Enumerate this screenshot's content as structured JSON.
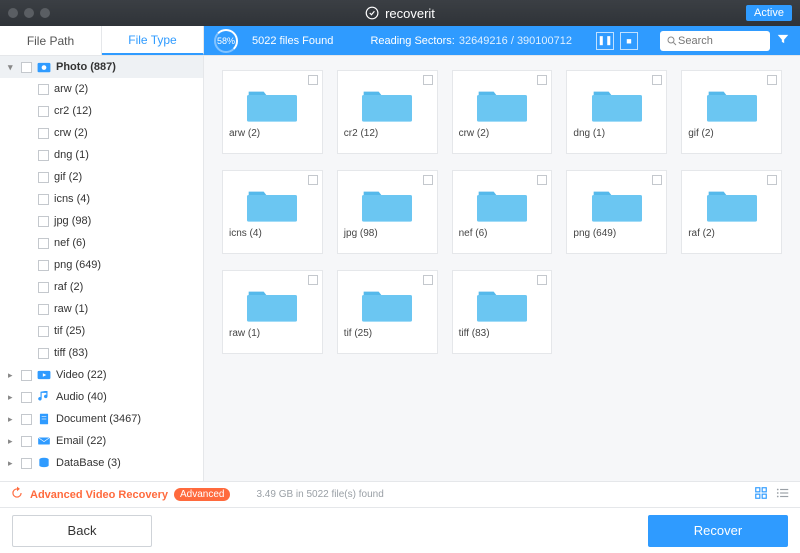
{
  "brand": "recoverit",
  "active_label": "Active",
  "tabs": {
    "path": "File Path",
    "type": "File Type"
  },
  "scan": {
    "percent": "58%",
    "found": "5022 files Found",
    "reading_label": "Reading Sectors:",
    "sectors": "32649216 / 390100712"
  },
  "search": {
    "placeholder": "Search"
  },
  "sidebar": {
    "categories": [
      {
        "name": "Photo (887)",
        "icon": "photo",
        "expanded": true,
        "selected": true,
        "children": [
          "arw (2)",
          "cr2 (12)",
          "crw (2)",
          "dng (1)",
          "gif (2)",
          "icns (4)",
          "jpg (98)",
          "nef (6)",
          "png (649)",
          "raf (2)",
          "raw (1)",
          "tif (25)",
          "tiff (83)"
        ]
      },
      {
        "name": "Video (22)",
        "icon": "video"
      },
      {
        "name": "Audio (40)",
        "icon": "audio"
      },
      {
        "name": "Document (3467)",
        "icon": "document"
      },
      {
        "name": "Email (22)",
        "icon": "email"
      },
      {
        "name": "DataBase (3)",
        "icon": "database"
      }
    ]
  },
  "grid": [
    "arw (2)",
    "cr2 (12)",
    "crw (2)",
    "dng (1)",
    "gif (2)",
    "icns (4)",
    "jpg (98)",
    "nef (6)",
    "png (649)",
    "raf (2)",
    "raw (1)",
    "tif (25)",
    "tiff (83)"
  ],
  "advanced": {
    "label": "Advanced Video Recovery",
    "badge": "Advanced"
  },
  "status": "3.49 GB in 5022 file(s) found",
  "buttons": {
    "back": "Back",
    "recover": "Recover"
  }
}
